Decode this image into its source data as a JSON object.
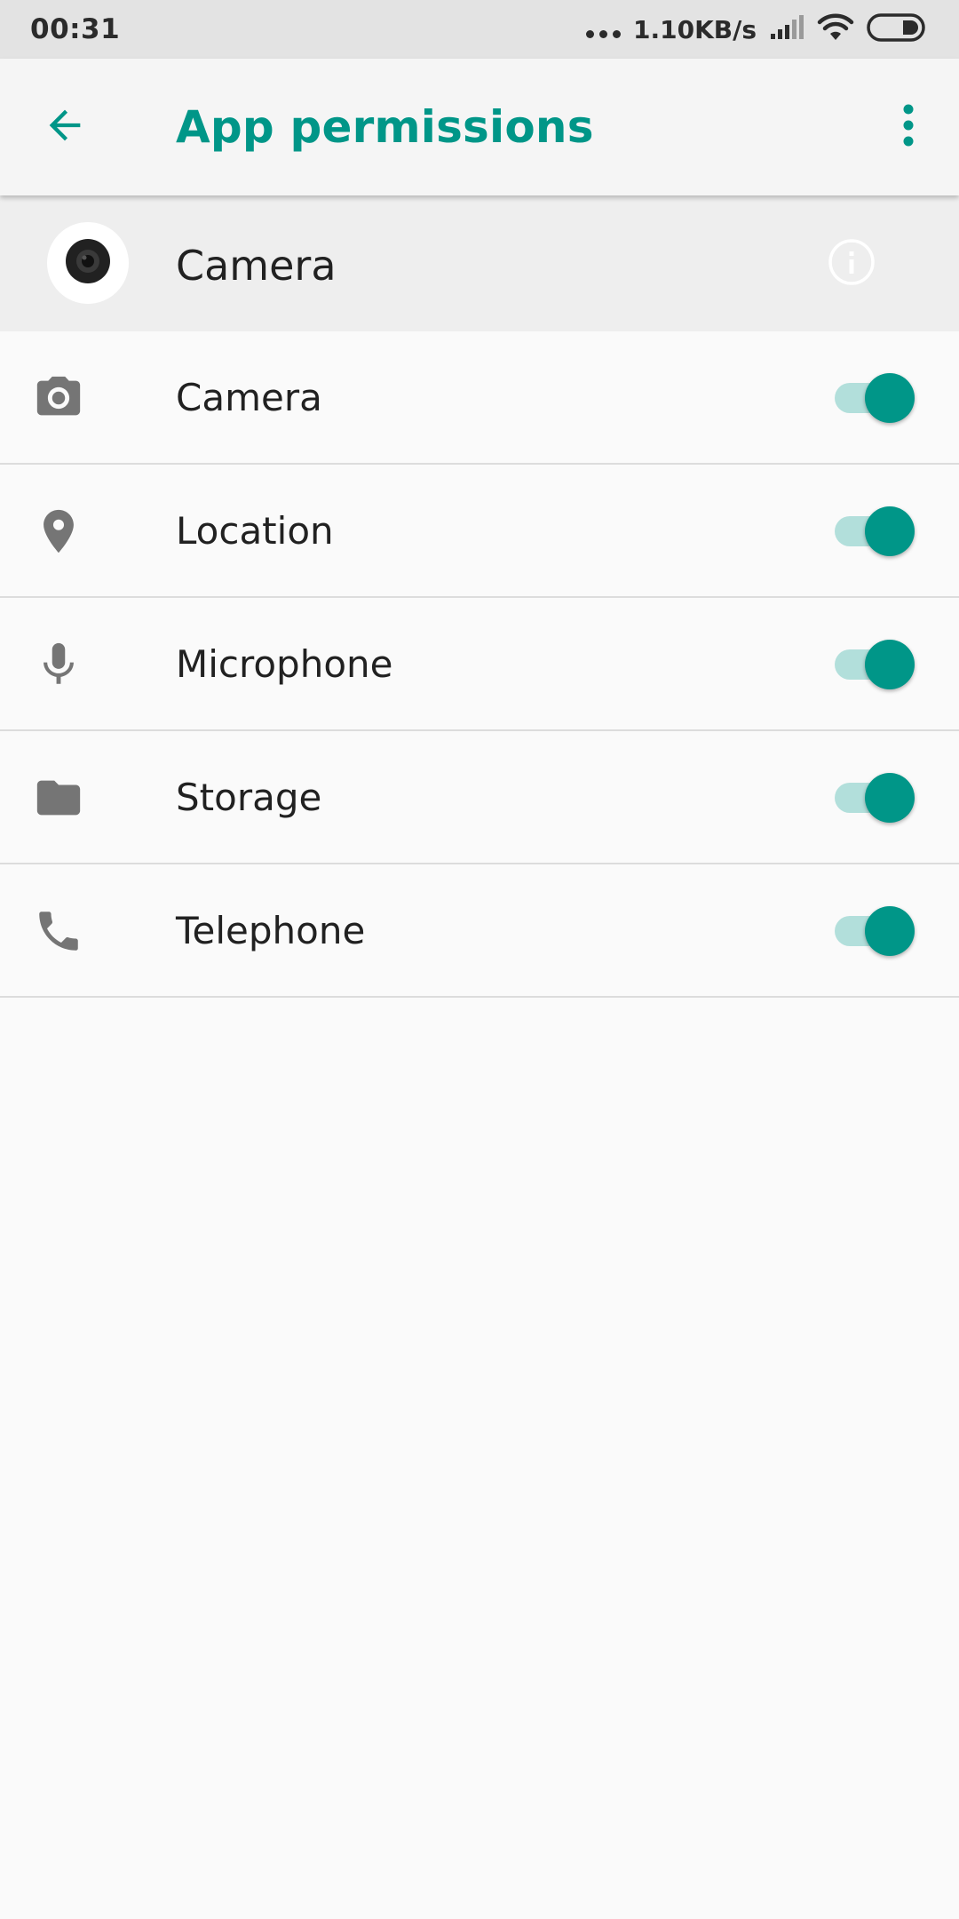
{
  "status_bar": {
    "time": "00:31",
    "network_speed": "1.10KB/s",
    "icons": [
      "more-dots-icon",
      "signal-icon",
      "wifi-icon",
      "battery-icon"
    ]
  },
  "toolbar": {
    "title": "App permissions",
    "back_icon": "arrow-back-icon",
    "overflow_icon": "more-vert-icon"
  },
  "app": {
    "name": "Camera",
    "icon": "camera-lens-icon",
    "info_icon": "info-icon"
  },
  "permissions": [
    {
      "label": "Camera",
      "icon": "camera-icon",
      "enabled": true
    },
    {
      "label": "Location",
      "icon": "location-pin-icon",
      "enabled": true
    },
    {
      "label": "Microphone",
      "icon": "microphone-icon",
      "enabled": true
    },
    {
      "label": "Storage",
      "icon": "folder-icon",
      "enabled": true
    },
    {
      "label": "Telephone",
      "icon": "phone-icon",
      "enabled": true
    }
  ],
  "colors": {
    "accent": "#009688",
    "toggle_track": "#b2dfdb",
    "icon_gray": "#757575",
    "text": "#212121"
  }
}
